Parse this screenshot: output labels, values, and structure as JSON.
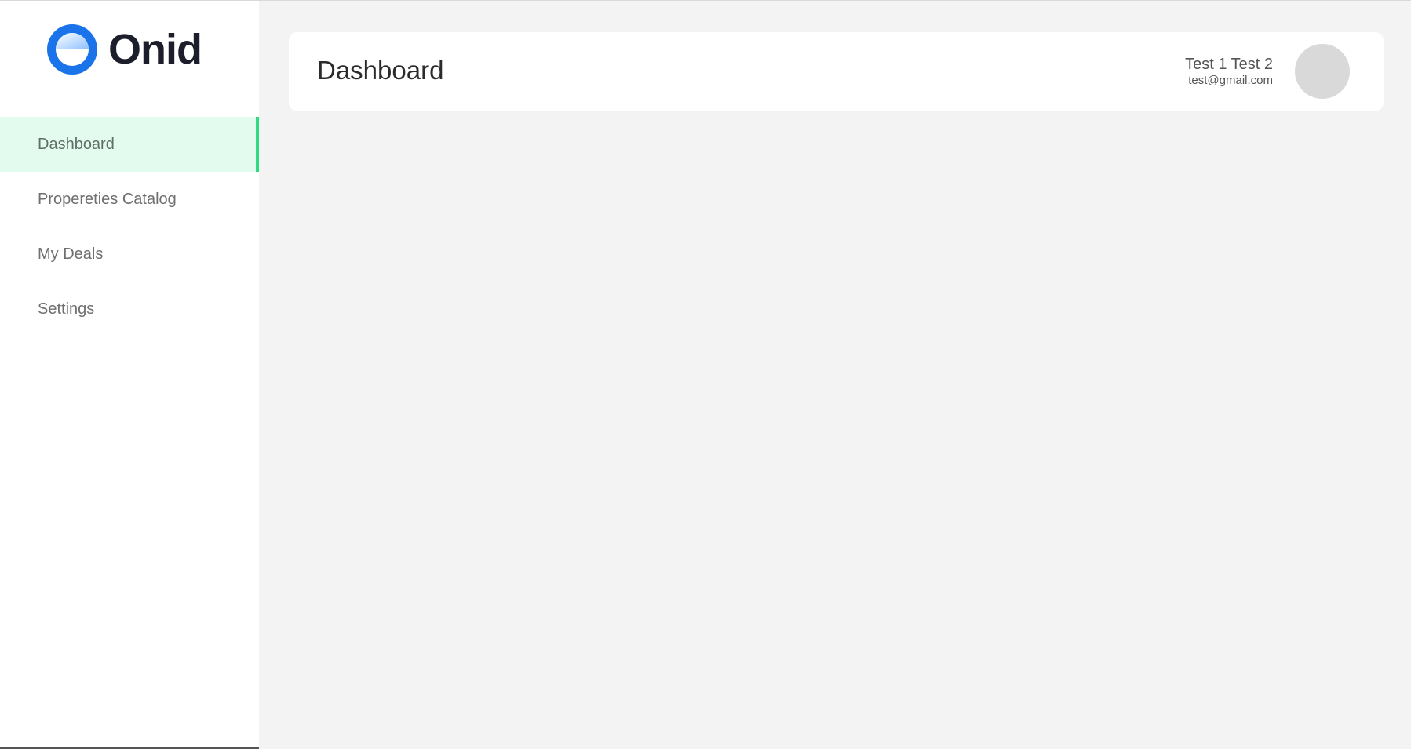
{
  "app": {
    "brand_name": "Onid",
    "brand_color": "#1a73e8"
  },
  "sidebar": {
    "items": [
      {
        "label": "Dashboard",
        "active": true
      },
      {
        "label": "Propereties Catalog",
        "active": false
      },
      {
        "label": "My Deals",
        "active": false
      },
      {
        "label": "Settings",
        "active": false
      }
    ],
    "active_accent_color": "#2edb7f",
    "active_bg_color": "#e3fbee"
  },
  "header": {
    "title": "Dashboard",
    "user": {
      "name": "Test 1 Test 2",
      "email": "test@gmail.com"
    }
  }
}
